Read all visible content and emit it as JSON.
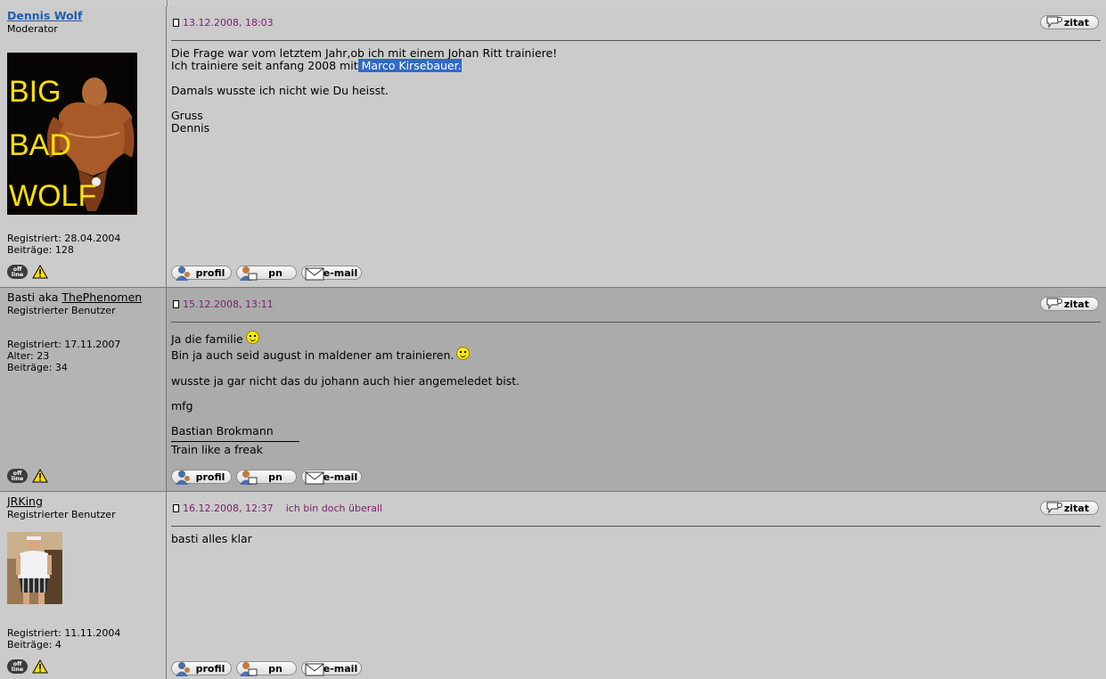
{
  "buttons": {
    "profil": "profil",
    "pn": "pn",
    "email": "e-mail",
    "zitat": "zitat"
  },
  "status": {
    "offline_line1": "off",
    "offline_line2": "line"
  },
  "posts": [
    {
      "author": "Dennis Wolf",
      "rank": "Moderator",
      "avatar_text": [
        "BIG",
        "BAD",
        "WOLF"
      ],
      "registered": "Registriert: 28.04.2004",
      "posts_count": "Beiträge: 128",
      "date": "13.12.2008, 18:03",
      "lines": {
        "l1": "Die Frage war vom letztem Jahr,ob ich mit einem Johan Ritt trainiere!",
        "l2_pre": "Ich trainiere seit anfang 2008 mit",
        "l2_sel": " Marco Kirsebauer.",
        "l3": "Damals wusste ich nicht wie Du heisst.",
        "l4": "Gruss",
        "l5": "Dennis"
      }
    },
    {
      "author_prefix": "Basti aka ",
      "author": "ThePhenomen",
      "rank": "Registrierter Benutzer",
      "registered": "Registriert: 17.11.2007",
      "age": "Alter: 23",
      "posts_count": "Beiträge: 34",
      "date": "15.12.2008, 13:11",
      "lines": {
        "l1": "Ja die familie",
        "l2": "Bin ja auch seid august in maldener am trainieren.",
        "l3": "wusste ja gar nicht das du johann auch hier angemeledet bist.",
        "l4": "mfg",
        "l5": "Bastian Brokmann",
        "sig": "Train like a freak"
      }
    },
    {
      "author": "JRKing",
      "rank": "Registrierter Benutzer",
      "registered": "Registriert: 11.11.2004",
      "posts_count": "Beiträge: 4",
      "date": "16.12.2008, 12:37",
      "subject": "ich bin doch überall",
      "lines": {
        "l1": "basti alles klar"
      }
    }
  ]
}
